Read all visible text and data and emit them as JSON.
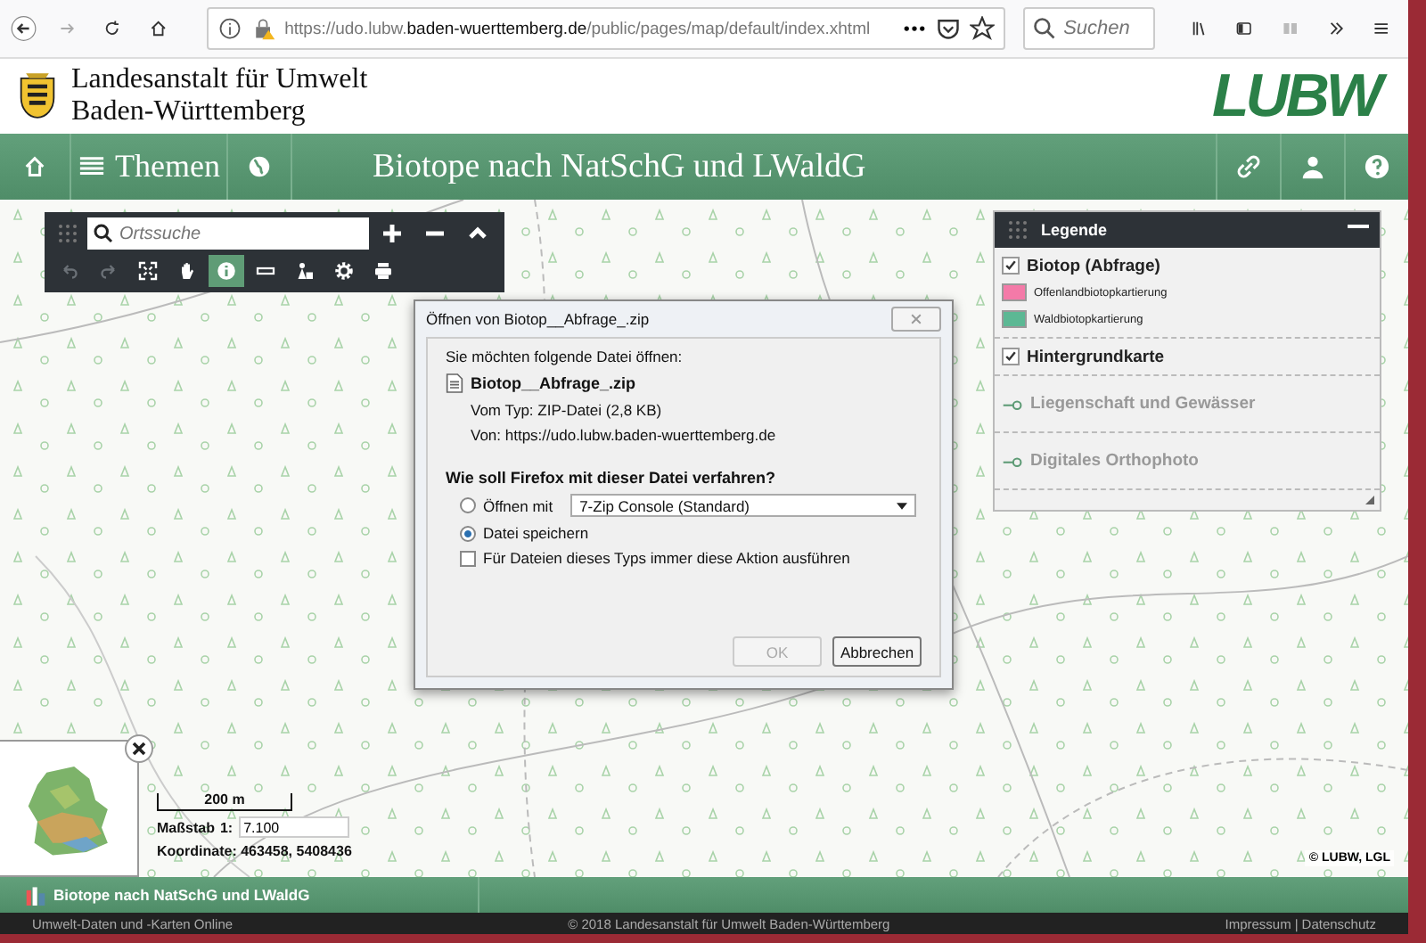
{
  "browser": {
    "url_prefix": "https://udo.lubw.",
    "url_host": "baden-wuerttemberg.de",
    "url_path": "/public/pages/map/default/index.xhtml",
    "search_placeholder": "Suchen"
  },
  "header": {
    "org_line1": "Landesanstalt für Umwelt",
    "org_line2": "Baden-Württemberg",
    "logo": "LUBW"
  },
  "nav": {
    "themes": "Themen",
    "title": "Biotope nach NatSchG und LWaldG"
  },
  "map_tools": {
    "search_placeholder": "Ortssuche",
    "tools": [
      {
        "kind": "undo",
        "disabled": true,
        "selected": false
      },
      {
        "kind": "redo",
        "disabled": true,
        "selected": false
      },
      {
        "kind": "extent",
        "disabled": false,
        "selected": false
      },
      {
        "kind": "pan",
        "disabled": false,
        "selected": false
      },
      {
        "kind": "info",
        "disabled": false,
        "selected": true
      },
      {
        "kind": "measure",
        "disabled": false,
        "selected": false
      },
      {
        "kind": "select",
        "disabled": false,
        "selected": false
      },
      {
        "kind": "settings",
        "disabled": false,
        "selected": false
      },
      {
        "kind": "print",
        "disabled": false,
        "selected": false
      }
    ]
  },
  "dialog": {
    "title": "Öffnen von Biotop__Abfrage_.zip",
    "intro": "Sie möchten folgende Datei öffnen:",
    "file_name": "Biotop__Abfrage_.zip",
    "type_line": "Vom Typ: ZIP-Datei (2,8 KB)",
    "from_line": "Von: https://udo.lubw.baden-wuerttemberg.de",
    "question": "Wie soll Firefox mit dieser Datei verfahren?",
    "options": [
      {
        "label": "Öffnen mit",
        "selected": false
      },
      {
        "label": "Datei speichern",
        "selected": true
      }
    ],
    "app_select": "7-Zip Console (Standard)",
    "remember": {
      "label": "Für Dateien dieses Typs immer diese Aktion ausführen",
      "checked": false
    },
    "buttons": [
      {
        "label": "OK",
        "disabled": true
      },
      {
        "label": "Abbrechen",
        "disabled": false
      }
    ]
  },
  "legend": {
    "title": "Legende",
    "groups": [
      {
        "kind": "checkbox",
        "label": "Biotop (Abfrage)",
        "checked": true,
        "items": [
          {
            "label": "Offenlandbiotopkartierung",
            "color": "#f47aa8"
          },
          {
            "label": "Waldbiotopkartierung",
            "color": "#5cb894"
          }
        ]
      },
      {
        "kind": "checkbox",
        "label": "Hintergrundkarte",
        "checked": true
      },
      {
        "kind": "link",
        "label": "Liegenschaft und Gewässer"
      },
      {
        "kind": "link",
        "label": "Digitales Orthophoto"
      }
    ]
  },
  "scale": {
    "bar_label": "200 m",
    "label": "Maßstab",
    "prefix": "1:",
    "value": "7.100",
    "coordinates": "Koordinate: 463458, 5408436"
  },
  "attribution": "© LUBW, LGL",
  "app_bar": {
    "title": "Biotope nach NatSchG und LWaldG"
  },
  "footer": {
    "left": "Umwelt-Daten und -Karten Online",
    "center": "© 2018 Landesanstalt für Umwelt Baden-Württemberg",
    "links": [
      "Impressum",
      "Datenschutz"
    ],
    "separator": "|"
  }
}
